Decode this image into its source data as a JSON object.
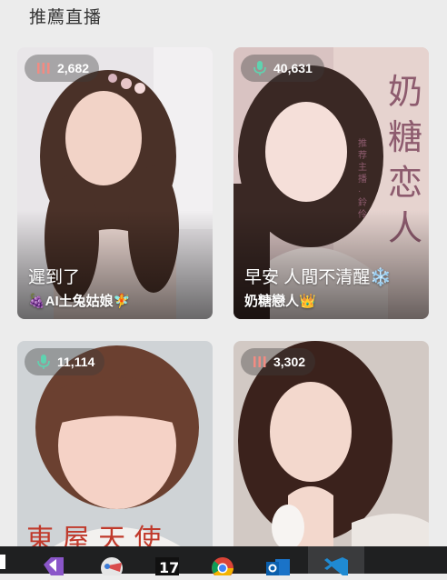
{
  "section": {
    "title": "推薦直播"
  },
  "cards": [
    {
      "viewers": "2,682",
      "viewer_icon": "bars-icon",
      "title": "遲到了",
      "streamer": "🍇AI土兔姑娘🧚"
    },
    {
      "viewers": "40,631",
      "viewer_icon": "microphone-icon",
      "title": "早安 人間不清醒❄️",
      "streamer": "奶糖戀人👑",
      "poster_text": "奶糖恋人",
      "poster_subtext": "推荐主播 · 鈴伶"
    },
    {
      "viewers": "11,114",
      "viewer_icon": "microphone-icon"
    },
    {
      "viewers": "3,302",
      "viewer_icon": "bars-icon"
    }
  ],
  "taskbar": {
    "apps": [
      "visual-studio-icon",
      "snipping-tool-icon",
      "trading-app-icon",
      "chrome-icon",
      "outlook-icon",
      "vscode-icon"
    ]
  },
  "colors": {
    "bars_icon": "#f28b82",
    "mic_icon": "#5fd3b0"
  }
}
